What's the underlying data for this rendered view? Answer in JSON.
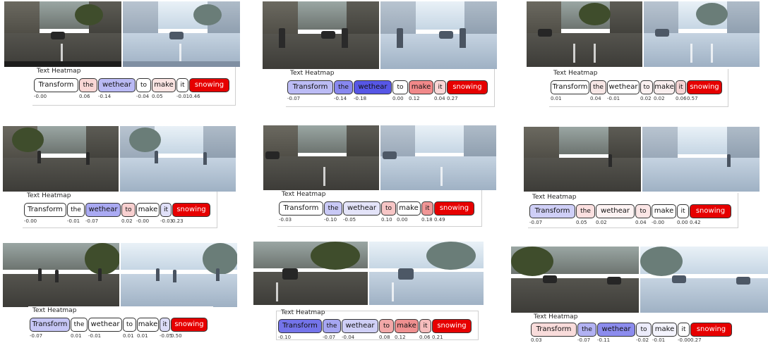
{
  "heatmap_title": "Text Heatmap",
  "tokens": [
    "Transform",
    "the",
    "wethear",
    "to",
    "make",
    "it",
    "snowing"
  ],
  "panels": [
    {
      "scores": [
        "-0.00",
        "0.06",
        "-0.14",
        "-0.04",
        "0.05",
        "-0.01",
        "0.46"
      ],
      "colors": [
        "#ffffff",
        "#f9d7d5",
        "#b9b9f4",
        "#ffffff",
        "#fae4e2",
        "#ffffff",
        "#e60000"
      ]
    },
    {
      "scores": [
        "-0.07",
        "-0.14",
        "-0.18",
        "0.00",
        "0.12",
        "0.04",
        "0.27"
      ],
      "colors": [
        "#bcbcf5",
        "#8888ef",
        "#5757e6",
        "#ffffff",
        "#f1898a",
        "#fad6d6",
        "#e60000"
      ]
    },
    {
      "scores": [
        "0.01",
        "0.04",
        "-0.01",
        "0.02",
        "0.02",
        "0.06",
        "0.57"
      ],
      "colors": [
        "#ffffff",
        "#f7e7e6",
        "#ffffff",
        "#fbf1f1",
        "#f9eeee",
        "#f5d5d5",
        "#e60000"
      ]
    },
    {
      "scores": [
        "-0.00",
        "-0.01",
        "-0.07",
        "0.02",
        "-0.00",
        "-0.03",
        "0.23"
      ],
      "colors": [
        "#ffffff",
        "#ffffff",
        "#aaaaf3",
        "#f8d0d0",
        "#ffffff",
        "#e0e0f9",
        "#e60000"
      ]
    },
    {
      "scores": [
        "-0.03",
        "-0.10",
        "-0.05",
        "0.10",
        "0.00",
        "0.18",
        "0.49"
      ],
      "colors": [
        "#ffffff",
        "#c9c9f6",
        "#e4e4f9",
        "#f7c6c6",
        "#ffffff",
        "#f19696",
        "#e60000"
      ]
    },
    {
      "scores": [
        "-0.07",
        "0.05",
        "0.02",
        "0.04",
        "-0.00",
        "0.00",
        "0.42"
      ],
      "colors": [
        "#cfcff7",
        "#fbe0e0",
        "#fdf3f3",
        "#fbe6e6",
        "#ffffff",
        "#ffffff",
        "#e60000"
      ]
    },
    {
      "scores": [
        "-0.07",
        "0.01",
        "-0.01",
        "0.01",
        "0.01",
        "-0.05",
        "0.50"
      ],
      "colors": [
        "#c6c6f5",
        "#ffffff",
        "#ffffff",
        "#ffffff",
        "#ffffff",
        "#dcdcf8",
        "#e60000"
      ]
    },
    {
      "scores": [
        "-0.10",
        "-0.07",
        "-0.04",
        "0.08",
        "0.12",
        "0.06",
        "0.21"
      ],
      "colors": [
        "#7474ea",
        "#a6a6f2",
        "#cfcff6",
        "#f2a8a8",
        "#ef9090",
        "#f6bdbd",
        "#e60000"
      ]
    },
    {
      "scores": [
        "0.03",
        "-0.07",
        "-0.11",
        "-0.02",
        "-0.01",
        "-0.00",
        "0.27"
      ],
      "colors": [
        "#f9dcdb",
        "#b2b2f3",
        "#8c8cee",
        "#ececfb",
        "#f4f4fd",
        "#ffffff",
        "#e60000"
      ]
    }
  ]
}
